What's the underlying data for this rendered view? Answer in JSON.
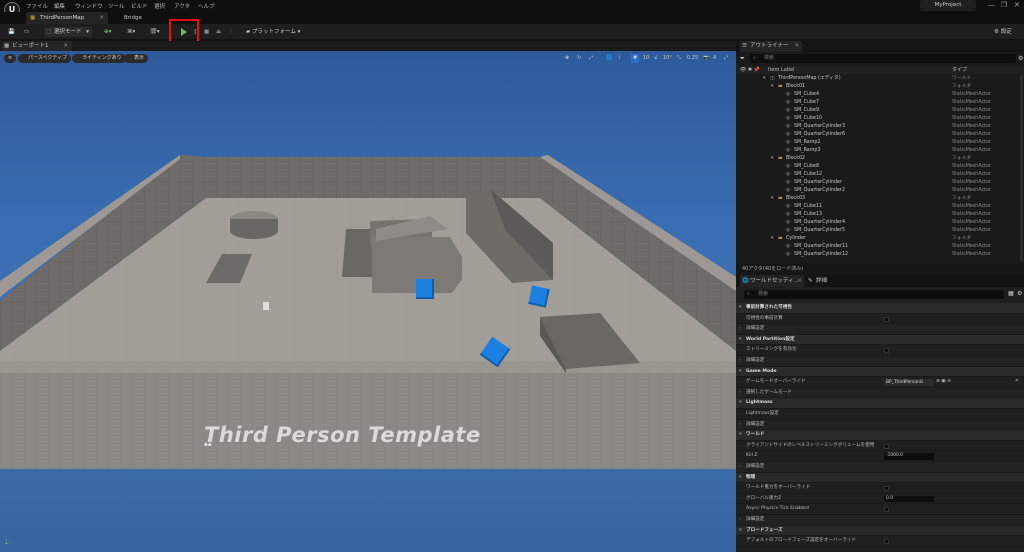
{
  "menu": {
    "logo": "U",
    "items": [
      "ファイル",
      "編集",
      "ウィンドウ",
      "ツール",
      "ビルド",
      "選択",
      "アクタ",
      "ヘルプ"
    ],
    "project": "MyProject"
  },
  "tabs": {
    "map": "ThirdPersonMap",
    "bridge": "Bridge"
  },
  "toolbar": {
    "select_mode": "選択モード",
    "platform": "プラットフォーム",
    "settings": "設定"
  },
  "viewport": {
    "tab": "ビューポート1",
    "perspective": "パースペクティブ",
    "lighting": "ライティングあり",
    "show": "表示",
    "grid_snap": "10",
    "rot_snap": "10°",
    "scale_snap": "0.25",
    "cam_speed": "4",
    "floor_text": "Third Person Template"
  },
  "outliner": {
    "tab": "アウトライナー",
    "search_placeholder": "検索",
    "col_label": "Item Label",
    "col_type": "タイプ",
    "rows": [
      {
        "name": "ThirdPersonMap (エディタ)",
        "type": "ワールド",
        "indent": 0,
        "folder": false
      },
      {
        "name": "Block01",
        "type": "フォルダ",
        "indent": 1,
        "folder": true
      },
      {
        "name": "SM_Cube4",
        "type": "StaticMeshActor",
        "indent": 2,
        "folder": false
      },
      {
        "name": "SM_Cube7",
        "type": "StaticMeshActor",
        "indent": 2,
        "folder": false
      },
      {
        "name": "SM_Cube9",
        "type": "StaticMeshActor",
        "indent": 2,
        "folder": false
      },
      {
        "name": "SM_Cube10",
        "type": "StaticMeshActor",
        "indent": 2,
        "folder": false
      },
      {
        "name": "SM_QuarterCylinder3",
        "type": "StaticMeshActor",
        "indent": 2,
        "folder": false
      },
      {
        "name": "SM_QuarterCylinder6",
        "type": "StaticMeshActor",
        "indent": 2,
        "folder": false
      },
      {
        "name": "SM_Ramp2",
        "type": "StaticMeshActor",
        "indent": 2,
        "folder": false
      },
      {
        "name": "SM_Ramp3",
        "type": "StaticMeshActor",
        "indent": 2,
        "folder": false
      },
      {
        "name": "Block02",
        "type": "フォルダ",
        "indent": 1,
        "folder": true
      },
      {
        "name": "SM_Cube8",
        "type": "StaticMeshActor",
        "indent": 2,
        "folder": false
      },
      {
        "name": "SM_Cube12",
        "type": "StaticMeshActor",
        "indent": 2,
        "folder": false
      },
      {
        "name": "SM_QuarterCylinder",
        "type": "StaticMeshActor",
        "indent": 2,
        "folder": false
      },
      {
        "name": "SM_QuarterCylinder2",
        "type": "StaticMeshActor",
        "indent": 2,
        "folder": false
      },
      {
        "name": "Block03",
        "type": "フォルダ",
        "indent": 1,
        "folder": true
      },
      {
        "name": "SM_Cube11",
        "type": "StaticMeshActor",
        "indent": 2,
        "folder": false
      },
      {
        "name": "SM_Cube13",
        "type": "StaticMeshActor",
        "indent": 2,
        "folder": false
      },
      {
        "name": "SM_QuarterCylinder4",
        "type": "StaticMeshActor",
        "indent": 2,
        "folder": false
      },
      {
        "name": "SM_QuarterCylinder5",
        "type": "StaticMeshActor",
        "indent": 2,
        "folder": false
      },
      {
        "name": "Cylinder",
        "type": "フォルダ",
        "indent": 1,
        "folder": true
      },
      {
        "name": "SM_QuarterCylinder11",
        "type": "StaticMeshActor",
        "indent": 2,
        "folder": false
      },
      {
        "name": "SM_QuarterCylinder12",
        "type": "StaticMeshActor",
        "indent": 2,
        "folder": false
      }
    ],
    "status": "40アクタ(40をロード済み)"
  },
  "details": {
    "tab_world": "ワールドセッティ...",
    "tab_details": "詳細",
    "search_placeholder": "検索",
    "rows": [
      {
        "kind": "section",
        "label": "事前計算された可視性",
        "ctrl": ""
      },
      {
        "kind": "prop",
        "label": "可視性の事前計算",
        "ctrl": "check"
      },
      {
        "kind": "sub",
        "label": "詳細設定",
        "ctrl": ""
      },
      {
        "kind": "section",
        "label": "World Partition設定",
        "ctrl": ""
      },
      {
        "kind": "prop",
        "label": "ストリーミングを有効化",
        "ctrl": "check"
      },
      {
        "kind": "sub",
        "label": "詳細設定",
        "ctrl": ""
      },
      {
        "kind": "section",
        "label": "Game Mode",
        "ctrl": ""
      },
      {
        "kind": "prop",
        "label": "ゲームモードオーバーライド",
        "ctrl": "dropdown",
        "value": "BP_ThirdPersonG"
      },
      {
        "kind": "sub",
        "label": "選択したゲームモード",
        "ctrl": ""
      },
      {
        "kind": "section",
        "label": "Lightmass",
        "ctrl": ""
      },
      {
        "kind": "prop",
        "label": "Lightmass設定",
        "ctrl": ""
      },
      {
        "kind": "sub",
        "label": "詳細設定",
        "ctrl": ""
      },
      {
        "kind": "section",
        "label": "ワールド",
        "ctrl": ""
      },
      {
        "kind": "prop",
        "label": "クライアントサイドのレベルストリーミングボリュームを使用",
        "ctrl": "check"
      },
      {
        "kind": "prop",
        "label": "Kill Z",
        "ctrl": "value",
        "value": "-1000.0"
      },
      {
        "kind": "sub",
        "label": "詳細設定",
        "ctrl": ""
      },
      {
        "kind": "section",
        "label": "物理",
        "ctrl": ""
      },
      {
        "kind": "prop",
        "label": "ワールド重力をオーバーライド",
        "ctrl": "check"
      },
      {
        "kind": "prop",
        "label": "グローバル重力Z",
        "ctrl": "value",
        "value": "0.0"
      },
      {
        "kind": "prop",
        "label": "Async Physics Tick Enabled",
        "ctrl": "check"
      },
      {
        "kind": "sub",
        "label": "詳細設定",
        "ctrl": ""
      },
      {
        "kind": "section",
        "label": "ブロードフェーズ",
        "ctrl": ""
      },
      {
        "kind": "prop",
        "label": "デフォルトのブロードフェーズ設定をオーバーライド",
        "ctrl": "check"
      }
    ]
  },
  "colors": {
    "play": "#5ac25a",
    "highlight": "#e01010",
    "sky": "#3a6eb2",
    "cube": "#1d7fe0",
    "folder": "#c9a04a"
  }
}
